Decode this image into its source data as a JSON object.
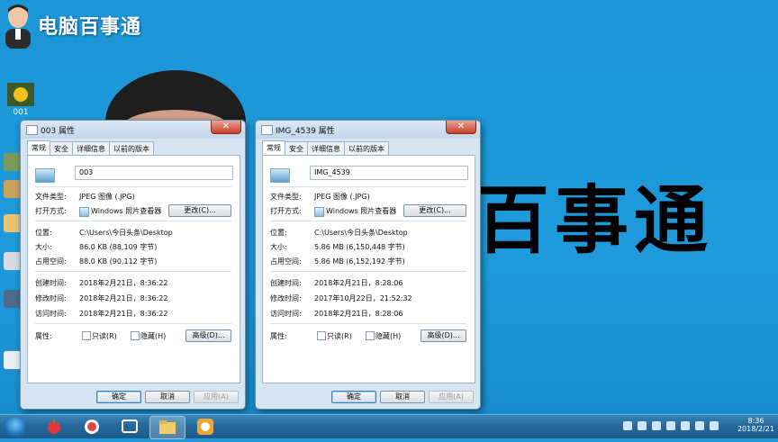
{
  "brand": {
    "title": "电脑百事通"
  },
  "desktop": {
    "big_text": "百事通",
    "icons": [
      {
        "label": "001"
      }
    ]
  },
  "dialogs": [
    {
      "title": "003 属性",
      "tabs": [
        "常规",
        "安全",
        "详细信息",
        "以前的版本"
      ],
      "filename": "003",
      "type_label": "文件类型:",
      "type_value": "JPEG 图像 (.JPG)",
      "open_label": "打开方式:",
      "open_value": "Windows 照片查看器",
      "change_button": "更改(C)...",
      "loc_label": "位置:",
      "loc_value": "C:\\Users\\今日头条\\Desktop",
      "size_label": "大小:",
      "size_value": "86.0 KB (88,109 字节)",
      "disk_label": "占用空间:",
      "disk_value": "88.0 KB (90,112 字节)",
      "created_label": "创建时间:",
      "created_value": "2018年2月21日，8:36:22",
      "modified_label": "修改时间:",
      "modified_value": "2018年2月21日，8:36:22",
      "accessed_label": "访问时间:",
      "accessed_value": "2018年2月21日，8:36:22",
      "attr_label": "属性:",
      "readonly": "只读(R)",
      "hidden": "隐藏(H)",
      "advanced": "高级(D)...",
      "ok": "确定",
      "cancel": "取消",
      "apply": "应用(A)"
    },
    {
      "title": "IMG_4539 属性",
      "tabs": [
        "常规",
        "安全",
        "详细信息",
        "以前的版本"
      ],
      "filename": "IMG_4539",
      "type_label": "文件类型:",
      "type_value": "JPEG 图像 (.JPG)",
      "open_label": "打开方式:",
      "open_value": "Windows 照片查看器",
      "change_button": "更改(C)...",
      "loc_label": "位置:",
      "loc_value": "C:\\Users\\今日头条\\Desktop",
      "size_label": "大小:",
      "size_value": "5.86 MB (6,150,448 字节)",
      "disk_label": "占用空间:",
      "disk_value": "5.86 MB (6,152,192 字节)",
      "created_label": "创建时间:",
      "created_value": "2018年2月21日，8:28:06",
      "modified_label": "修改时间:",
      "modified_value": "2017年10月22日，21:52:32",
      "accessed_label": "访问时间:",
      "accessed_value": "2018年2月21日，8:28:06",
      "attr_label": "属性:",
      "readonly": "只读(R)",
      "hidden": "隐藏(H)",
      "advanced": "高级(D)...",
      "ok": "确定",
      "cancel": "取消",
      "apply": "应用(A)"
    }
  ],
  "taskbar": {
    "time": "8:36",
    "date": "2018/2/21",
    "pinned_icons": [
      "start-orb",
      "fruit-app-icon",
      "record-app-icon",
      "media-app-icon",
      "folder-icon",
      "gallery-app-icon"
    ],
    "colors": {
      "accent": "#1d97d8",
      "taskbar": "#26699a"
    }
  }
}
